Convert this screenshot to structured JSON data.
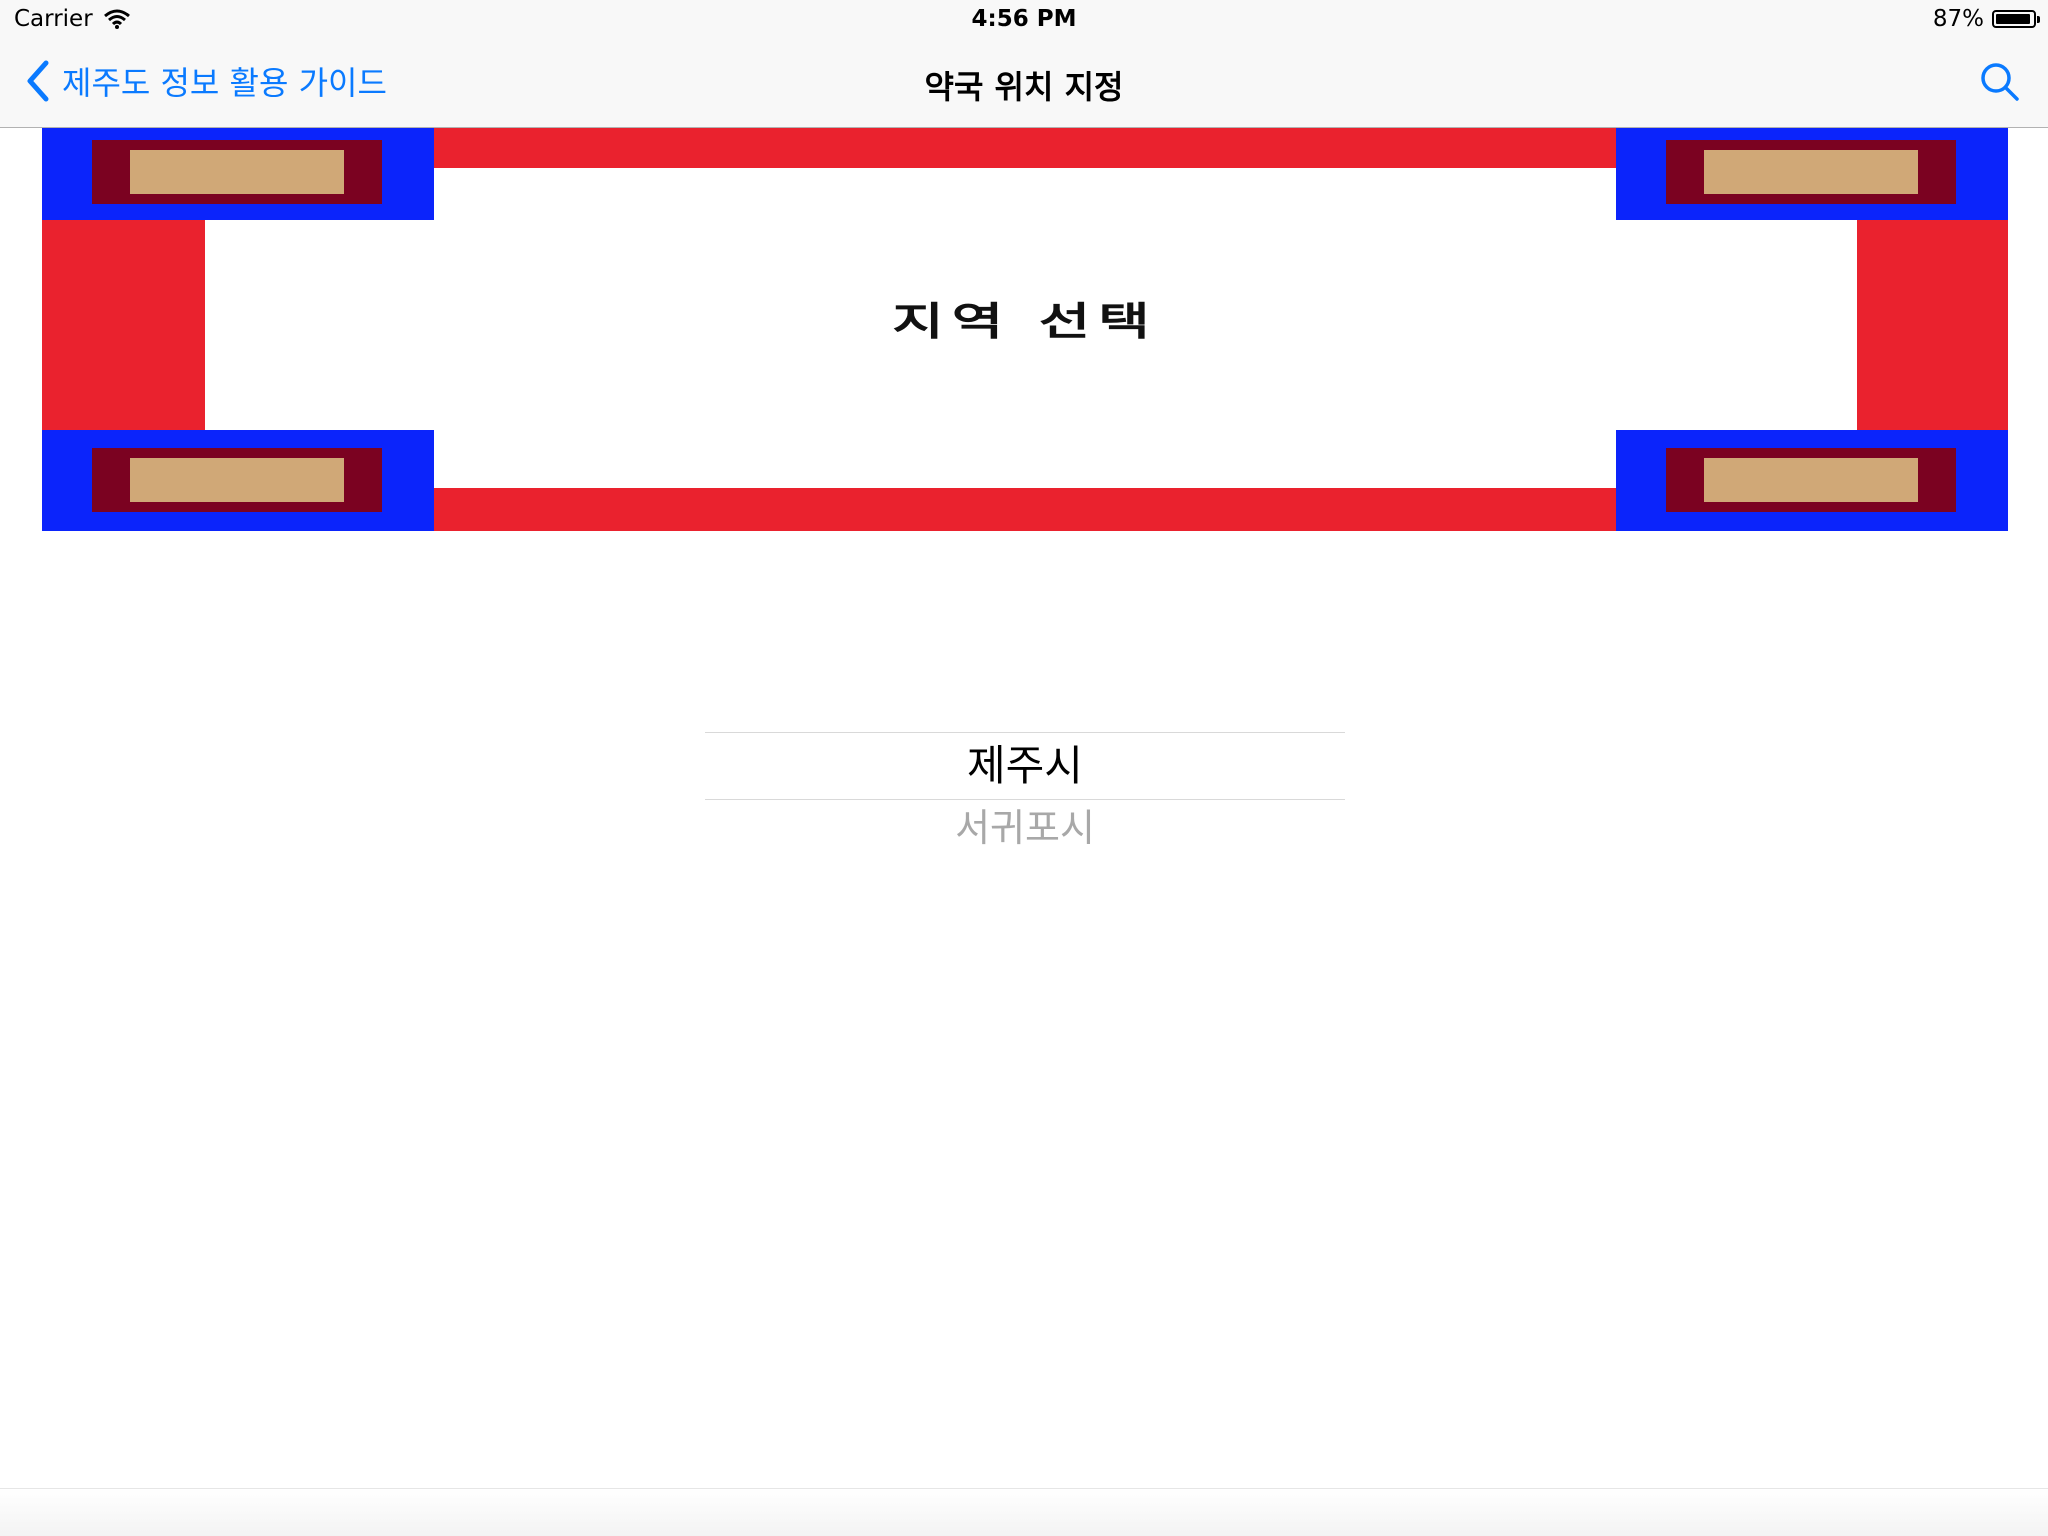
{
  "status_bar": {
    "carrier": "Carrier",
    "time": "4:56 PM",
    "battery": "87%"
  },
  "nav": {
    "back_label": "제주도 정보 활용 가이드",
    "title": "약국 위치 지정",
    "accent": "#0a7aff"
  },
  "banner": {
    "text": "지역 선택",
    "colors": {
      "red": "#ea222e",
      "blue": "#0b24fb",
      "maroon": "#7b0221",
      "tan": "#d0a877"
    }
  },
  "picker": {
    "selected": "제주시",
    "options": [
      "제주시",
      "서귀포시"
    ],
    "next": "서귀포시"
  }
}
